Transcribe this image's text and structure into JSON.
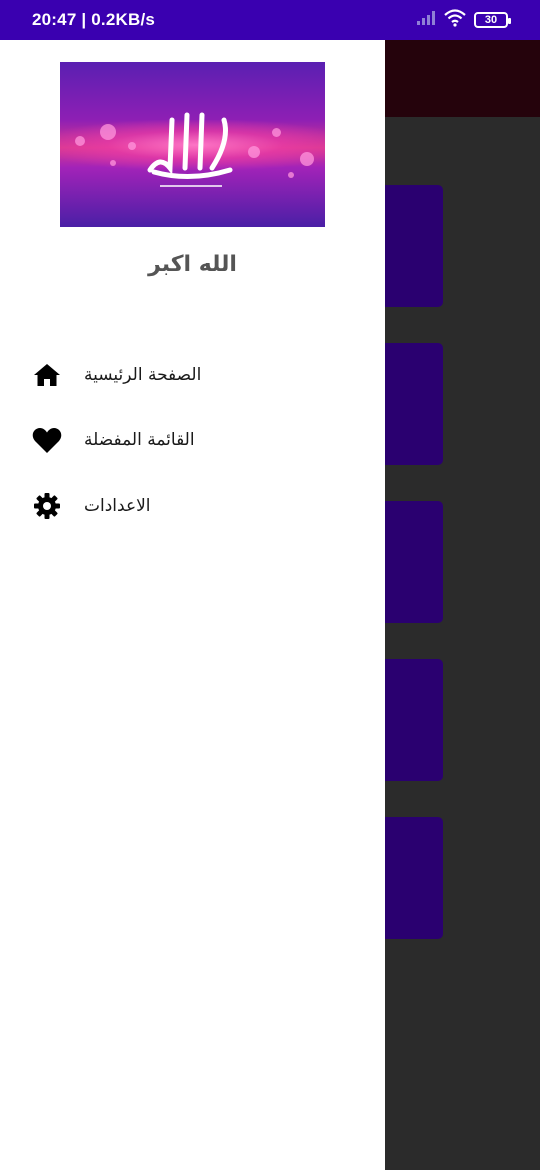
{
  "status_bar": {
    "time_speed": "20:47 | 0.2KB/s",
    "battery": "30",
    "icons": [
      "signal-icon",
      "wifi-icon",
      "battery-icon"
    ]
  },
  "drawer": {
    "title": "الله اكبر",
    "menu": [
      {
        "label": "الصفحة الرئيسية",
        "icon": "home-icon"
      },
      {
        "label": "القائمة المفضلة",
        "icon": "heart-icon"
      },
      {
        "label": "الاعدادات",
        "icon": "gear-icon"
      }
    ]
  },
  "colors": {
    "status_bar": "#3a00b0",
    "drawer_bg": "#ffffff",
    "card": "#2a0070",
    "background": "#2b2b2b"
  }
}
